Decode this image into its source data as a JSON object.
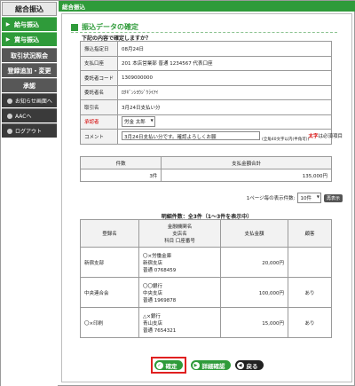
{
  "sidebar": {
    "active": "総合振込",
    "green_items": [
      "給与振込",
      "賞与振込"
    ],
    "dark_items": [
      "取引状況照会",
      "登録追加・変更",
      "承認"
    ],
    "bottom_items": [
      "お知らせ画面へ",
      "AACへ",
      "ログアウト"
    ]
  },
  "tab": {
    "label": "総合振込"
  },
  "page": {
    "title": "振込データの確定",
    "question": "下記の内容で確定しますか？"
  },
  "detail": {
    "rows": [
      {
        "label": "振込指定日",
        "value": "08月24日"
      },
      {
        "label": "支払口座",
        "value": "201 本店営業部 普通 1234567 代表口座"
      },
      {
        "label": "委託者コード",
        "value": "1309000000"
      },
      {
        "label": "委託者名",
        "value": "ﾛｸｷﾞﾝｼﾖｳｼﾞｳﾗｲｱｲ"
      },
      {
        "label": "取引名",
        "value": "3月24日支払い分"
      }
    ],
    "approver_label": "承認者",
    "approver_value": "労金 太郎",
    "comment_label": "コメント",
    "comment_value": "3月24日支払い分です。確認よろしくお願",
    "comment_note": "(全角40文字以内(半角可))"
  },
  "required_note": {
    "bold": "太字",
    "rest": "は必須項目"
  },
  "summary": {
    "headers": [
      "件数",
      "支払金額合計"
    ],
    "values": [
      "3件",
      "135,000円"
    ]
  },
  "pager": {
    "label": "1ページ毎の表示件数:",
    "selected": "10件",
    "button": "再表示"
  },
  "detail_count": "明細件数：全3件（1〜3件を表示中）",
  "list": {
    "headers": {
      "name": "登録名",
      "bank_l1": "金融機関名",
      "bank_l2": "支店名",
      "bank_l3": "科目 口座番号",
      "amount": "支払金額",
      "fee": "顧客"
    },
    "rows": [
      {
        "name": "新宿支部",
        "bank": "〇×労働金庫",
        "branch": "新宿支店",
        "account": "普通 0768459",
        "amount": "20,000円",
        "fee": ""
      },
      {
        "name": "中央連合会",
        "bank": "〇〇銀行",
        "branch": "中央支店",
        "account": "普通 1969878",
        "amount": "100,000円",
        "fee": "あり"
      },
      {
        "name": "〇×印刷",
        "bank": "△×銀行",
        "branch": "青山支店",
        "account": "普通 7654321",
        "amount": "15,000円",
        "fee": "あり"
      }
    ]
  },
  "actions": {
    "confirm": "確定",
    "detail": "詳細確認",
    "back": "戻る"
  }
}
